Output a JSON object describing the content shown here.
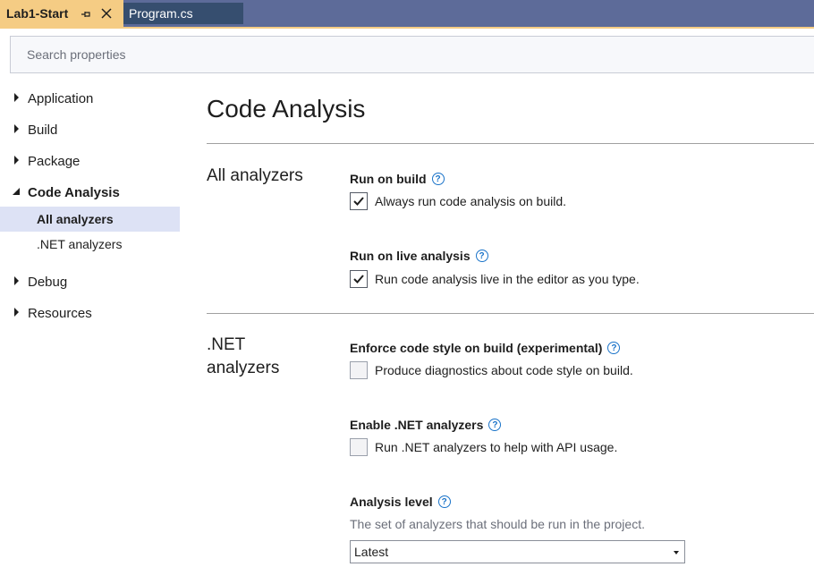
{
  "tabs": [
    {
      "label": "Lab1-Start",
      "active": true
    },
    {
      "label": "Program.cs",
      "active": false
    }
  ],
  "search": {
    "placeholder": "Search properties"
  },
  "sidebar": {
    "items": [
      {
        "label": "Application",
        "expanded": false
      },
      {
        "label": "Build",
        "expanded": false
      },
      {
        "label": "Package",
        "expanded": false
      },
      {
        "label": "Code Analysis",
        "expanded": true,
        "children": [
          {
            "label": "All analyzers",
            "selected": true
          },
          {
            "label": ".NET analyzers",
            "selected": false
          }
        ]
      },
      {
        "label": "Debug",
        "expanded": false
      },
      {
        "label": "Resources",
        "expanded": false
      }
    ]
  },
  "main": {
    "title": "Code Analysis",
    "sections": [
      {
        "title": "All analyzers",
        "settings": [
          {
            "label": "Run on build",
            "checkbox_text": "Always run code analysis on build.",
            "checked": true
          },
          {
            "label": "Run on live analysis",
            "checkbox_text": "Run code analysis live in the editor as you type.",
            "checked": true
          }
        ]
      },
      {
        "title_line1": ".NET",
        "title_line2": "analyzers",
        "settings": [
          {
            "label": "Enforce code style on build (experimental)",
            "checkbox_text": "Produce diagnostics about code style on build.",
            "checked": false
          },
          {
            "label": "Enable .NET analyzers",
            "checkbox_text": "Run .NET analyzers to help with API usage.",
            "checked": false
          }
        ],
        "analysis_level": {
          "label": "Analysis level",
          "description": "The set of analyzers that should be run in the project.",
          "selected": "Latest"
        }
      }
    ]
  },
  "help_glyph": "?",
  "colors": {
    "active_tab": "#f5cc84",
    "tab_strip": "#5d6b99",
    "selection": "#dde2f5",
    "help": "#1a73c9"
  }
}
